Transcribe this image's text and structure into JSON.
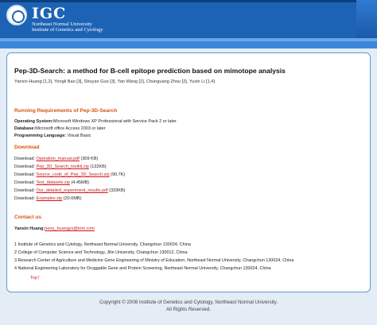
{
  "header": {
    "logo_text": "IGC",
    "logo_sub_line1": "Northeast Normal University",
    "logo_sub_line2": "Institute of Genetics and Cytology",
    "colors": {
      "header_bg": "#1d63b5",
      "nav_bg": "#3c86da",
      "accent": "#d9530f",
      "link": "#d01818"
    }
  },
  "paper": {
    "title": "Pep-3D-Search: a method for B-cell epitope prediction based on mimotope analysis",
    "authors": "Yanxin Huang [1,2], Yongli Bao [3], Shuyan Guo [3], Yan Wang [2], Chunguang Zhou [2], Yuxin Li [1,4]"
  },
  "requirements": {
    "heading": "Running Requirements of Pep-3D-Search",
    "os_label": "Operating System:",
    "os_value": "Microsoft Windows XP Professional with Service Pack 2 or later",
    "db_label": "Database:",
    "db_value": "Microsoft office Access 2003 or later",
    "lang_label": "Programming Language:",
    "lang_value": "Visual Basic"
  },
  "download": {
    "heading": "Download",
    "items": [
      {
        "prefix": "Download: ",
        "link": "Operation_manual.pdf",
        "size": " (309 KB)"
      },
      {
        "prefix": "Download: ",
        "link": "Pep_3D_Search_toolkit.zip",
        "size": " (132KB)"
      },
      {
        "prefix": "Download: ",
        "link": "Source_code_of_Pep_3D_Search.zip",
        "size": " (90.7K)"
      },
      {
        "prefix": "Download: ",
        "link": "Test_datasets.zip",
        "size": " (4.45MB)"
      },
      {
        "prefix": "Download: ",
        "link": "Our_detailed_experiment_results.pdf",
        "size": " (333KB)"
      },
      {
        "prefix": "Download: ",
        "link": "Examples.zip",
        "size": " (20.6MB)"
      }
    ]
  },
  "contact": {
    "heading": "Contact us",
    "name_label": "Yanxin Huang:",
    "email": "nenu_huangyx@tom.com"
  },
  "affiliations": [
    "1 Institute of Genetics and Cytology, Northeast Normal University, Changchun 130024, China",
    "2 College of Computer Science and Technology, Jilin University, Changchun 130012, China",
    "3 Research Center of Agriculture and Medicine Gene Engineering of Ministry of Education, Northeast Normal University, Changchun 130024, China",
    "4 National Engineering Laboratory for Druggable Gene and Protein Screening, Northeast Normal University, Changchun 130024, China"
  ],
  "top_link": {
    "label": "Top",
    "arrow": "↑"
  },
  "footer": {
    "line1": "Copyright © 2008 Institute of Genetics and Cytology, Northeast Normal University.",
    "line2": "All Rights Reserved."
  }
}
